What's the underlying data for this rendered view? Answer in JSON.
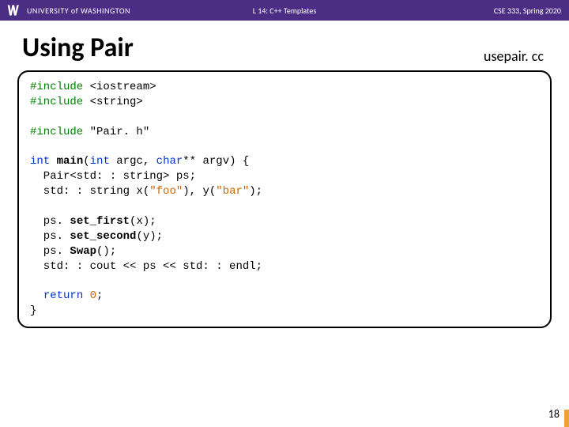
{
  "header": {
    "university": "UNIVERSITY of WASHINGTON",
    "lecture": "L 14:  C++ Templates",
    "course": "CSE 333, Spring 2020"
  },
  "title": "Using Pair",
  "filename": "usepair. cc",
  "code": {
    "l1a": "#include",
    "l1b": " <iostream>",
    "l2a": "#include",
    "l2b": " <string>",
    "l3a": "#include",
    "l3b": " \"Pair. h\"",
    "l4a": "int",
    "l4b": " ",
    "l4c": "main",
    "l4d": "(",
    "l4e": "int",
    "l4f": " argc, ",
    "l4g": "char",
    "l4h": "** argv) {",
    "l5": "  Pair<std: : string> ps;",
    "l6a": "  std: : string x(",
    "l6b": "\"foo\"",
    "l6c": "), y(",
    "l6d": "\"bar\"",
    "l6e": ");",
    "l7a": "  ps. ",
    "l7b": "set_first",
    "l7c": "(x);",
    "l8a": "  ps. ",
    "l8b": "set_second",
    "l8c": "(y);",
    "l9a": "  ps. ",
    "l9b": "Swap",
    "l9c": "();",
    "l10": "  std: : cout << ps << std: : endl;",
    "l11a": "  ",
    "l11b": "return",
    "l11c": " ",
    "l11d": "0",
    "l11e": ";",
    "l12": "}"
  },
  "pagenum": "18"
}
